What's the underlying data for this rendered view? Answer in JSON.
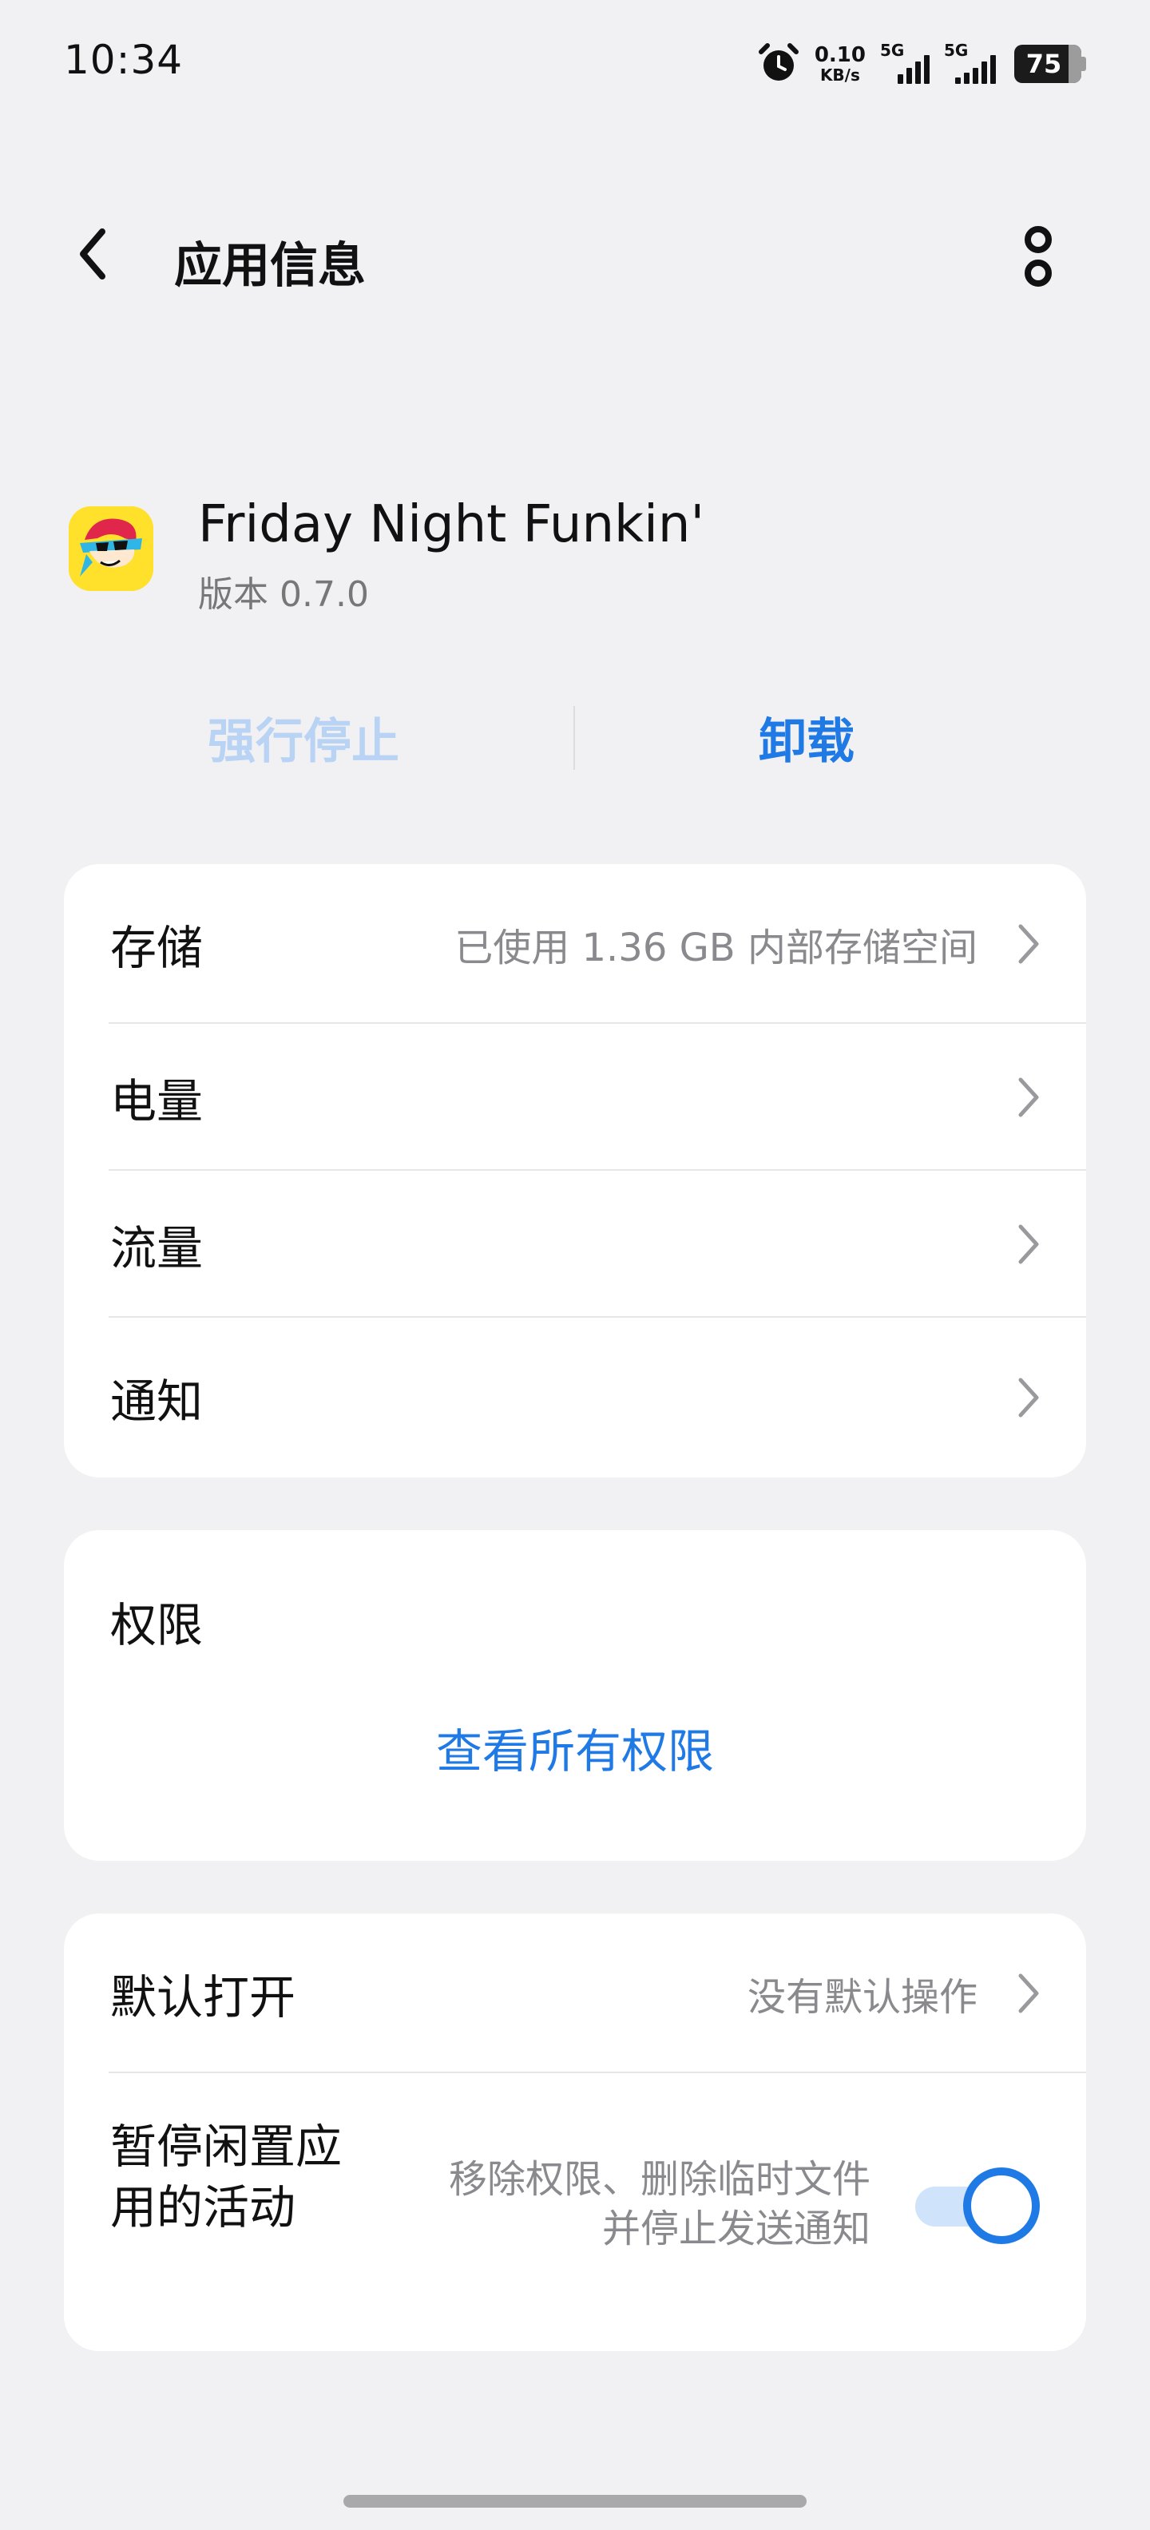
{
  "status_bar": {
    "time": "10:34",
    "net_speed_value": "0.10",
    "net_speed_unit": "KB/s",
    "sim1_label": "5G",
    "sim2_label": "5G",
    "battery_level": "75"
  },
  "header": {
    "title": "应用信息",
    "back_icon": "chevron-left-icon",
    "more_icon": "more-vertical-icon"
  },
  "app": {
    "name": "Friday Night Funkin'",
    "version": "版本 0.7.0",
    "icon": "app-icon"
  },
  "actions": {
    "force_stop": "强行停止",
    "uninstall": "卸载"
  },
  "card_general": {
    "rows": [
      {
        "label": "存储",
        "value": "已使用 1.36 GB 内部存储空间"
      },
      {
        "label": "电量",
        "value": ""
      },
      {
        "label": "流量",
        "value": ""
      },
      {
        "label": "通知",
        "value": ""
      }
    ]
  },
  "card_permissions": {
    "title": "权限",
    "link": "查看所有权限"
  },
  "card_defaults": {
    "default_open_label": "默认打开",
    "default_open_value": "没有默认操作",
    "pause_label": "暂停闲置应用的活动",
    "pause_desc": "移除权限、删除临时文件并停止发送通知",
    "pause_enabled": true
  },
  "colors": {
    "accent": "#1f7ae6",
    "disabled_accent": "#b9d3f4",
    "background": "#f1f1f3",
    "card": "#ffffff",
    "secondary_text": "#8a8a8e"
  }
}
